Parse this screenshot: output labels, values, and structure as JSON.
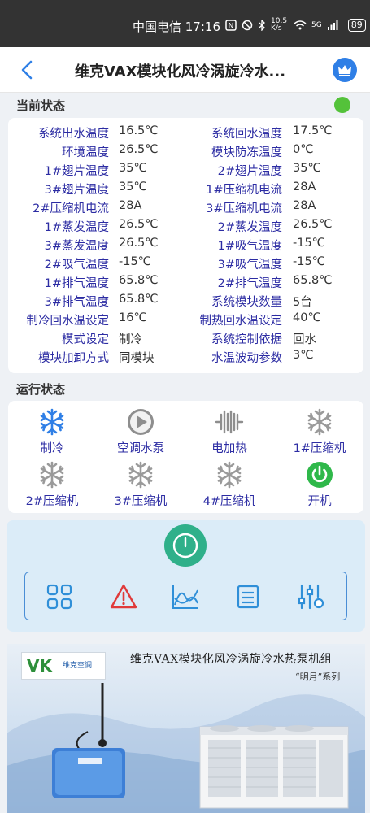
{
  "statusbar": {
    "carrier_time": "中国电信 17:16",
    "net_speed": "10.5 K/s",
    "signal": "5G",
    "battery": "89",
    "icons": [
      "nfc-icon",
      "silent-icon",
      "bluetooth-icon",
      "wifi-icon",
      "signal-icon"
    ]
  },
  "header": {
    "title": "维克VAX模块化风冷涡旋冷水...",
    "back_icon": "chevron-left-icon",
    "crown_icon": "crown-icon",
    "accent": "#2f7fe6"
  },
  "current_status": {
    "title": "当前状态",
    "indicator_color": "#54c23a",
    "rows": [
      {
        "l1": "系统出水温度",
        "v1": "16.5℃",
        "l2": "系统回水温度",
        "v2": "17.5℃"
      },
      {
        "l1": "环境温度",
        "v1": "26.5℃",
        "l2": "模块防冻温度",
        "v2": "0℃"
      },
      {
        "l1": "1#翅片温度",
        "v1": "35℃",
        "l2": "2#翅片温度",
        "v2": "35℃"
      },
      {
        "l1": "3#翅片温度",
        "v1": "35℃",
        "l2": "1#压缩机电流",
        "v2": "28A"
      },
      {
        "l1": "2#压缩机电流",
        "v1": "28A",
        "l2": "3#压缩机电流",
        "v2": "28A"
      },
      {
        "l1": "1#蒸发温度",
        "v1": "26.5℃",
        "l2": "2#蒸发温度",
        "v2": "26.5℃"
      },
      {
        "l1": "3#蒸发温度",
        "v1": "26.5℃",
        "l2": "1#吸气温度",
        "v2": "-15℃"
      },
      {
        "l1": "2#吸气温度",
        "v1": "-15℃",
        "l2": "3#吸气温度",
        "v2": "-15℃"
      },
      {
        "l1": "1#排气温度",
        "v1": "65.8℃",
        "l2": "2#排气温度",
        "v2": "65.8℃"
      },
      {
        "l1": "3#排气温度",
        "v1": "65.8℃",
        "l2": "系统模块数量",
        "v2": "5台"
      },
      {
        "l1": "制冷回水温设定",
        "v1": "16℃",
        "l2": "制热回水温设定",
        "v2": "40℃"
      },
      {
        "l1": "模式设定",
        "v1": "制冷",
        "l2": "系统控制依据",
        "v2": "回水"
      },
      {
        "l1": "模块加卸方式",
        "v1": "同模块",
        "l2": "水温波动参数",
        "v2": "3℃"
      }
    ]
  },
  "run_status": {
    "title": "运行状态",
    "items": [
      {
        "label": "制冷",
        "icon": "snowflake-icon",
        "active": true
      },
      {
        "label": "空调水泵",
        "icon": "pump-icon",
        "active": false
      },
      {
        "label": "电加热",
        "icon": "heater-icon",
        "active": false
      },
      {
        "label": "1#压缩机",
        "icon": "snowflake-icon",
        "active": false
      },
      {
        "label": "2#压缩机",
        "icon": "snowflake-icon",
        "active": false
      },
      {
        "label": "3#压缩机",
        "icon": "snowflake-icon",
        "active": false
      },
      {
        "label": "4#压缩机",
        "icon": "snowflake-icon",
        "active": false
      },
      {
        "label": "开机",
        "icon": "power-icon",
        "active": true
      }
    ]
  },
  "controls": {
    "power_icon": "power-icon",
    "tools": [
      "grid-icon",
      "alarm-icon",
      "curve-icon",
      "list-icon",
      "settings-sliders-icon"
    ]
  },
  "banner": {
    "logo_mark": "VK",
    "logo_text": "维克空调",
    "title": "维克VAX模块化风冷涡旋冷水热泵机组",
    "subtitle": "“明月”系列"
  }
}
